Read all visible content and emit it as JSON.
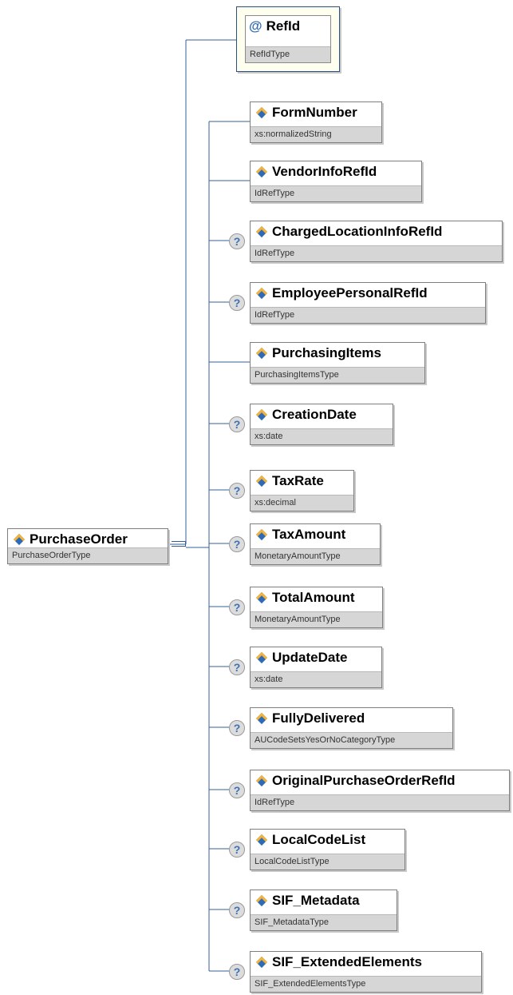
{
  "colors": {
    "connector": "#355f93",
    "type_bar": "#d6d6d6",
    "icon_blue": "#2e6bb6",
    "icon_orange": "#f3b23b",
    "attribute_bg": "#fffff0"
  },
  "root": {
    "name": "PurchaseOrder",
    "type": "PurchaseOrderType",
    "icon": "element-icon"
  },
  "attribute": {
    "name": "RefId",
    "type": "RefIdType",
    "icon": "at-icon",
    "symbol": "@"
  },
  "optional_symbol": "?",
  "children": [
    {
      "name": "FormNumber",
      "type": "xs:normalizedString",
      "optional": false
    },
    {
      "name": "VendorInfoRefId",
      "type": "IdRefType",
      "optional": false
    },
    {
      "name": "ChargedLocationInfoRefId",
      "type": "IdRefType",
      "optional": true
    },
    {
      "name": "EmployeePersonalRefId",
      "type": "IdRefType",
      "optional": true
    },
    {
      "name": "PurchasingItems",
      "type": "PurchasingItemsType",
      "optional": false
    },
    {
      "name": "CreationDate",
      "type": "xs:date",
      "optional": true
    },
    {
      "name": "TaxRate",
      "type": "xs:decimal",
      "optional": true
    },
    {
      "name": "TaxAmount",
      "type": "MonetaryAmountType",
      "optional": true
    },
    {
      "name": "TotalAmount",
      "type": "MonetaryAmountType",
      "optional": true
    },
    {
      "name": "UpdateDate",
      "type": "xs:date",
      "optional": true
    },
    {
      "name": "FullyDelivered",
      "type": "AUCodeSetsYesOrNoCategoryType",
      "optional": true
    },
    {
      "name": "OriginalPurchaseOrderRefId",
      "type": "IdRefType",
      "optional": true
    },
    {
      "name": "LocalCodeList",
      "type": "LocalCodeListType",
      "optional": true
    },
    {
      "name": "SIF_Metadata",
      "type": "SIF_MetadataType",
      "optional": true
    },
    {
      "name": "SIF_ExtendedElements",
      "type": "SIF_ExtendedElementsType",
      "optional": true
    }
  ]
}
